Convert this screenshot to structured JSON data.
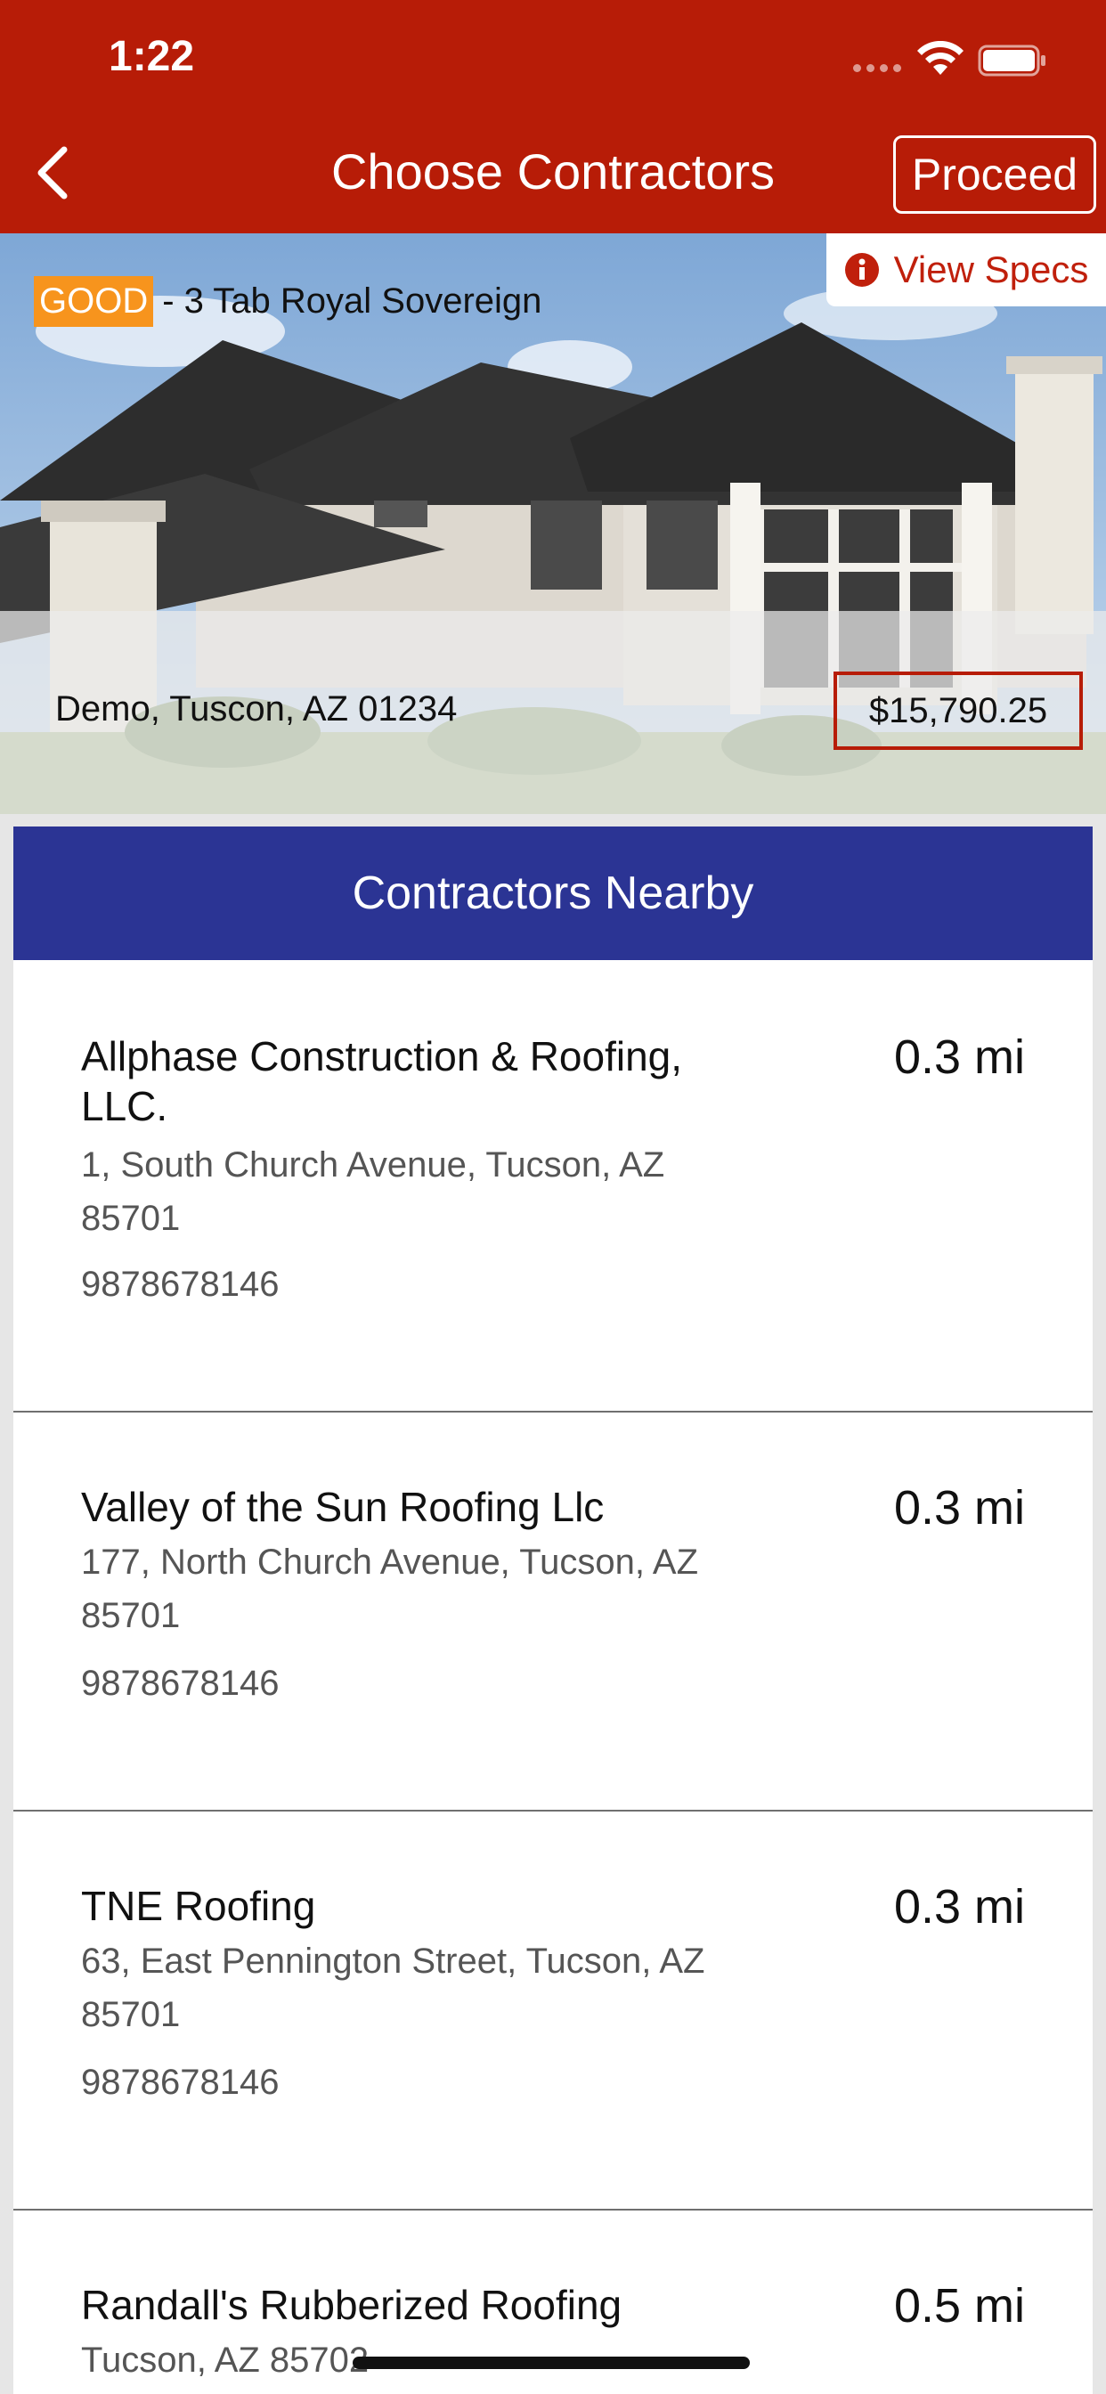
{
  "status_bar": {
    "time": "1:22",
    "signal_icon": "signal-dots-icon",
    "wifi_icon": "wifi-icon",
    "battery_icon": "battery-icon"
  },
  "nav": {
    "back_icon": "chevron-left-icon",
    "title": "Choose Contractors",
    "proceed_label": "Proceed"
  },
  "hero": {
    "tier_badge": "GOOD",
    "product_name": "- 3 Tab Royal Sovereign",
    "view_specs_label": "View Specs",
    "view_specs_icon": "info-icon",
    "address": "Demo, Tuscon, AZ 01234",
    "price": "$15,790.25"
  },
  "contractors": {
    "header": "Contractors Nearby",
    "items": [
      {
        "name": "Allphase Construction & Roofing, LLC.",
        "distance": "0.3 mi",
        "address": "1, South Church Avenue, Tucson, AZ 85701",
        "phone": "9878678146"
      },
      {
        "name": "Valley of the Sun Roofing Llc",
        "distance": "0.3 mi",
        "address": "177, North Church Avenue, Tucson, AZ 85701",
        "phone": "9878678146"
      },
      {
        "name": "TNE Roofing",
        "distance": "0.3 mi",
        "address": "63, East Pennington Street, Tucson, AZ 85701",
        "phone": "9878678146"
      },
      {
        "name": "Randall's Rubberized Roofing",
        "distance": "0.5 mi",
        "address": "Tucson, AZ 85702",
        "phone": ""
      }
    ]
  },
  "colors": {
    "nav_bar": "#b71c07",
    "section_header": "#2b3494",
    "tier_badge": "#f7941d",
    "accent_red": "#c0200c"
  }
}
